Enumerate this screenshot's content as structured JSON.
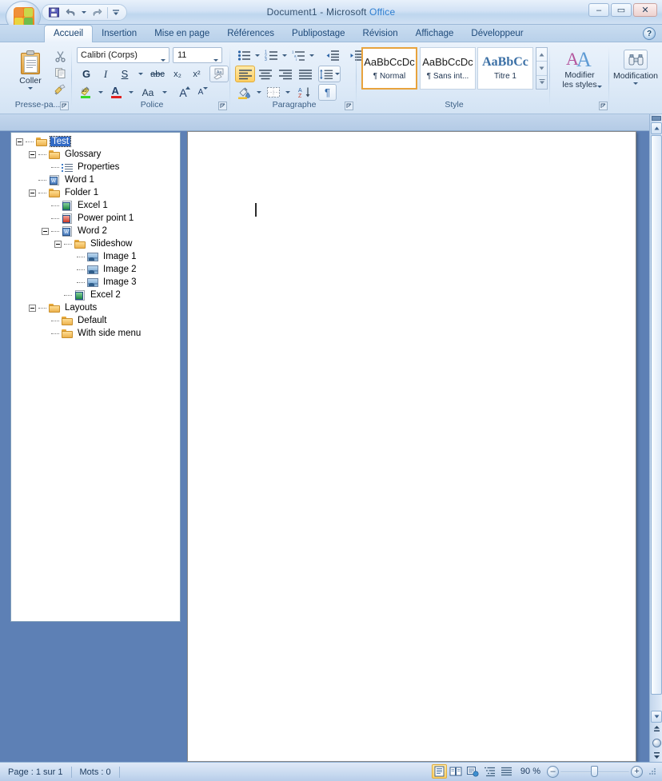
{
  "window": {
    "title_main": "Document1 - Microsoft ",
    "title_accent": "Office",
    "minimize": "–",
    "maximize": "▭",
    "close": "✕",
    "help_label": "?"
  },
  "quick_access": {
    "save": "save-icon",
    "undo": "undo-icon",
    "redo": "redo-icon",
    "customize": "customize-icon"
  },
  "tabs": [
    {
      "label": "Accueil",
      "active": true
    },
    {
      "label": "Insertion",
      "active": false
    },
    {
      "label": "Mise en page",
      "active": false
    },
    {
      "label": "Références",
      "active": false
    },
    {
      "label": "Publipostage",
      "active": false
    },
    {
      "label": "Révision",
      "active": false
    },
    {
      "label": "Affichage",
      "active": false
    },
    {
      "label": "Développeur",
      "active": false
    }
  ],
  "ribbon": {
    "clipboard": {
      "label": "Presse-pa...",
      "paste_label": "Coller",
      "cut": "scissors-icon",
      "copy": "copy-icon",
      "format_painter": "format-painter-icon"
    },
    "font": {
      "label": "Police",
      "font_name": "Calibri (Corps)",
      "font_size": "11",
      "bold": "G",
      "italic": "I",
      "underline": "S",
      "strikethrough": "abc",
      "subscript": "x₂",
      "superscript": "x²",
      "clear_format": "clear-formatting-icon",
      "highlight": "highlight-icon",
      "font_color": "A",
      "change_case": "Aa",
      "grow_font": "A",
      "shrink_font": "A"
    },
    "paragraph": {
      "label": "Paragraphe",
      "bullets": "bullet-list-icon",
      "numbering": "numbered-list-icon",
      "multilevel": "multilevel-list-icon",
      "decrease_indent": "decrease-indent-icon",
      "increase_indent": "increase-indent-icon",
      "align_left": "align-left-icon",
      "align_center": "align-center-icon",
      "align_right": "align-right-icon",
      "justify": "justify-icon",
      "line_spacing": "line-spacing-icon",
      "shading": "shading-icon",
      "borders": "borders-icon",
      "sort": "sort-icon",
      "show_marks": "¶"
    },
    "styles": {
      "label": "Style",
      "items": [
        {
          "sample": "AaBbCcDc",
          "name": "¶ Normal",
          "selected": true
        },
        {
          "sample": "AaBbCcDc",
          "name": "¶ Sans int...",
          "selected": false
        },
        {
          "sample": "AaBbCс",
          "name": "Titre 1",
          "selected": false,
          "heading": true
        }
      ]
    },
    "modify_styles": {
      "line1": "Modifier",
      "line2": "les styles"
    },
    "editing": {
      "label": "Modification",
      "icon": "binoculars-icon"
    }
  },
  "tree": {
    "items": [
      {
        "label": "Test",
        "depth": 0,
        "icon": "folder",
        "expander": "minus",
        "selected": true
      },
      {
        "label": "Glossary",
        "depth": 1,
        "icon": "folder",
        "expander": "minus",
        "selected": false
      },
      {
        "label": "Properties",
        "depth": 2,
        "icon": "props",
        "expander": "none",
        "selected": false
      },
      {
        "label": "Word 1",
        "depth": 1,
        "icon": "word",
        "expander": "none",
        "selected": false
      },
      {
        "label": "Folder 1",
        "depth": 1,
        "icon": "folder",
        "expander": "minus",
        "selected": false
      },
      {
        "label": "Excel 1",
        "depth": 2,
        "icon": "excel",
        "expander": "none",
        "selected": false
      },
      {
        "label": "Power point 1",
        "depth": 2,
        "icon": "ppt",
        "expander": "none",
        "selected": false
      },
      {
        "label": "Word 2",
        "depth": 2,
        "icon": "word",
        "expander": "minus",
        "selected": false
      },
      {
        "label": "Slideshow",
        "depth": 3,
        "icon": "folder",
        "expander": "minus",
        "selected": false
      },
      {
        "label": "Image 1",
        "depth": 4,
        "icon": "image",
        "expander": "none",
        "selected": false
      },
      {
        "label": "Image 2",
        "depth": 4,
        "icon": "image",
        "expander": "none",
        "selected": false
      },
      {
        "label": "Image 3",
        "depth": 4,
        "icon": "image",
        "expander": "none",
        "selected": false
      },
      {
        "label": "Excel 2",
        "depth": 3,
        "icon": "excel",
        "expander": "none",
        "selected": false
      },
      {
        "label": "Layouts",
        "depth": 1,
        "icon": "folder",
        "expander": "minus",
        "selected": false
      },
      {
        "label": "Default",
        "depth": 2,
        "icon": "folder",
        "expander": "none",
        "selected": false
      },
      {
        "label": "With side menu",
        "depth": 2,
        "icon": "folder",
        "expander": "none",
        "selected": false
      }
    ]
  },
  "status_bar": {
    "page": "Page : 1 sur 1",
    "words": "Mots : 0",
    "zoom_level": "90 %",
    "zoom_out": "–",
    "zoom_in": "+",
    "views": [
      {
        "name": "print-layout-view",
        "selected": true
      },
      {
        "name": "full-screen-reading-view",
        "selected": false
      },
      {
        "name": "web-layout-view",
        "selected": false
      },
      {
        "name": "outline-view",
        "selected": false
      },
      {
        "name": "draft-view",
        "selected": false
      }
    ]
  },
  "scrollbar": {
    "up": "▲",
    "down": "▼",
    "previous_page": "previous-page-icon",
    "select_browse_object": "select-browse-object-icon",
    "next_page": "next-page-icon"
  },
  "colors": {
    "desktop_blue": "#5d80b5",
    "accent_orange": "#e8a33d",
    "selection_blue": "#316ac5",
    "title_accent": "#2f7fd1"
  }
}
